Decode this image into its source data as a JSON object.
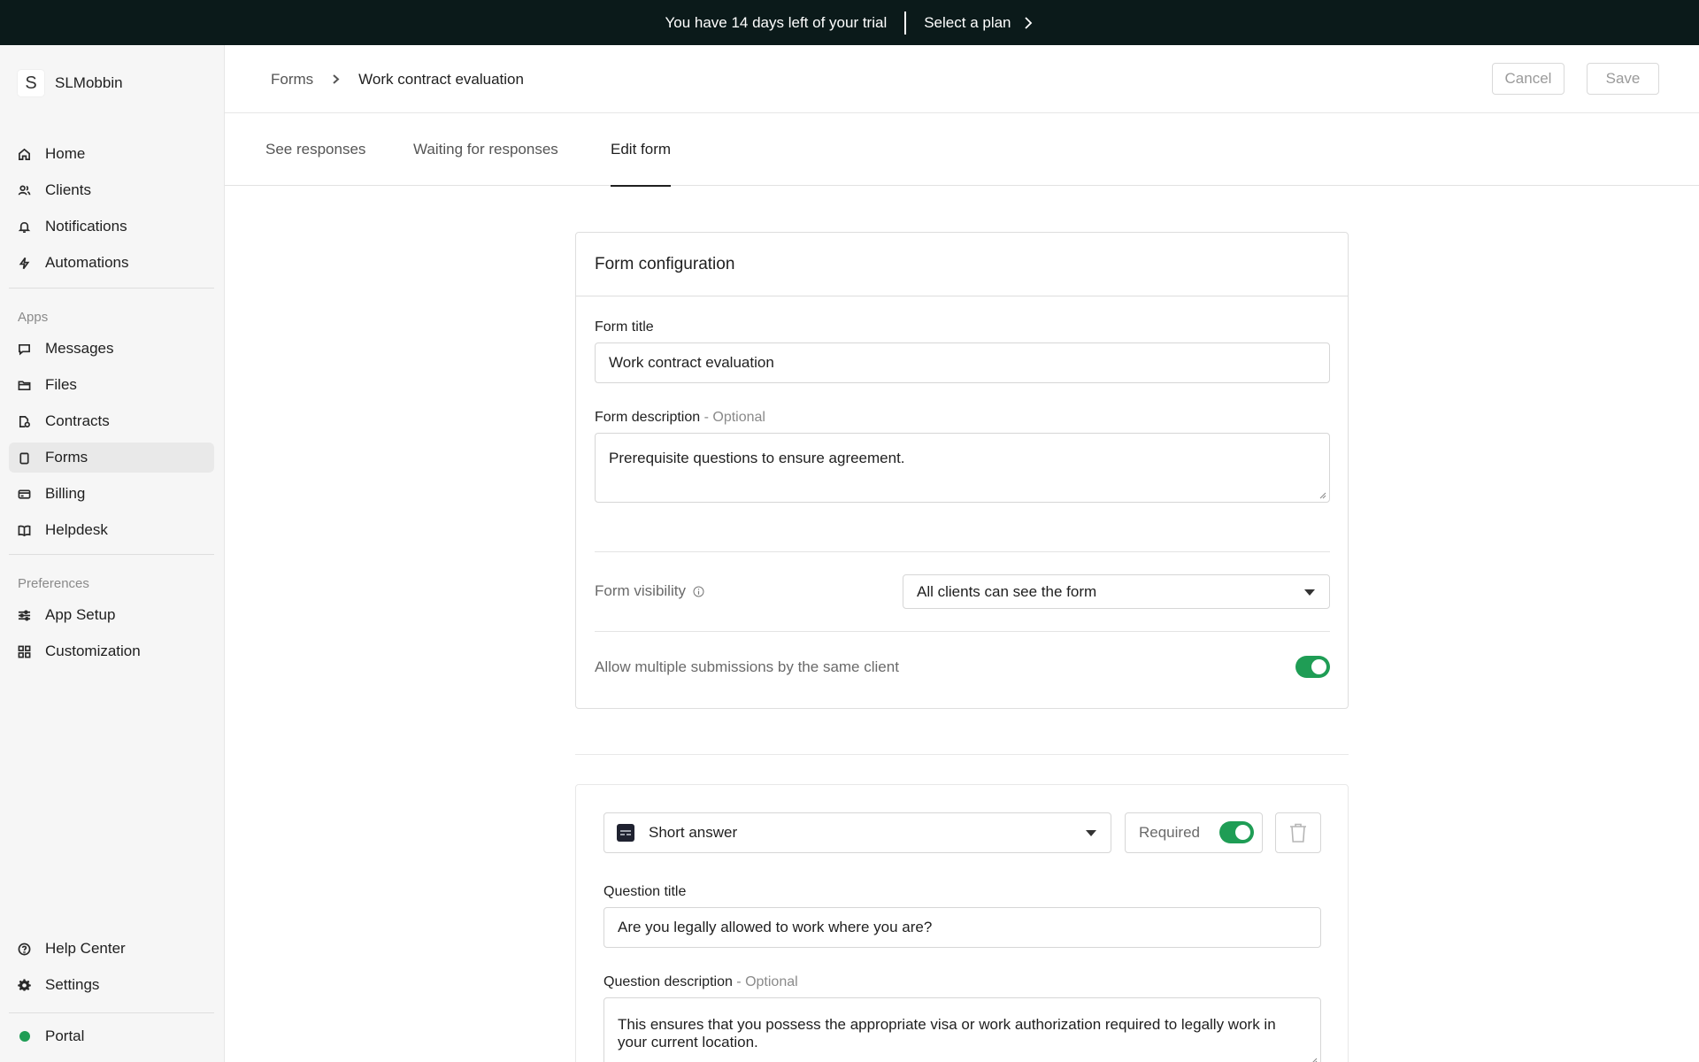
{
  "banner": {
    "trial_text": "You have 14 days left of your trial",
    "plan_link": "Select a plan"
  },
  "sidebar": {
    "brand_initial": "S",
    "brand_name": "SLMobbin",
    "main_items": [
      {
        "label": "Home",
        "icon": "home-icon"
      },
      {
        "label": "Clients",
        "icon": "users-icon"
      },
      {
        "label": "Notifications",
        "icon": "bell-icon"
      },
      {
        "label": "Automations",
        "icon": "bolt-icon"
      }
    ],
    "apps_heading": "Apps",
    "app_items": [
      {
        "label": "Messages",
        "icon": "message-icon"
      },
      {
        "label": "Files",
        "icon": "folder-icon"
      },
      {
        "label": "Contracts",
        "icon": "contract-icon"
      },
      {
        "label": "Forms",
        "icon": "clipboard-icon",
        "active": true
      },
      {
        "label": "Billing",
        "icon": "credit-card-icon"
      },
      {
        "label": "Helpdesk",
        "icon": "book-icon"
      }
    ],
    "preferences_heading": "Preferences",
    "pref_items": [
      {
        "label": "App Setup",
        "icon": "sliders-icon"
      },
      {
        "label": "Customization",
        "icon": "grid-icon"
      }
    ],
    "bottom_items": [
      {
        "label": "Help Center",
        "icon": "help-circle-icon"
      },
      {
        "label": "Settings",
        "icon": "gear-icon"
      }
    ],
    "portal_label": "Portal",
    "portal_status_color": "#1f9d55"
  },
  "header": {
    "breadcrumb_root": "Forms",
    "breadcrumb_current": "Work contract evaluation",
    "cancel_label": "Cancel",
    "save_label": "Save"
  },
  "tabs": [
    {
      "label": "See responses"
    },
    {
      "label": "Waiting for responses"
    },
    {
      "label": "Edit form",
      "active": true
    }
  ],
  "form_config": {
    "heading": "Form configuration",
    "title_label": "Form title",
    "title_value": "Work contract evaluation",
    "description_label": "Form description",
    "optional_suffix": " - Optional",
    "description_value": "Prerequisite questions to ensure agreement.",
    "visibility_label": "Form visibility",
    "visibility_value": "All clients can see the form",
    "multiple_label": "Allow multiple submissions by the same client",
    "multiple_enabled": true
  },
  "question": {
    "type_value": "Short answer",
    "required_label": "Required",
    "required_enabled": true,
    "title_label": "Question title",
    "title_value": "Are you legally allowed to work where you are?",
    "description_label": "Question description",
    "optional_suffix": " - Optional",
    "description_value": "This ensures that you possess the appropriate visa or work authorization required to legally work in your current location."
  },
  "colors": {
    "banner_bg": "#0b1a1a",
    "toggle_on": "#1f9d55"
  }
}
